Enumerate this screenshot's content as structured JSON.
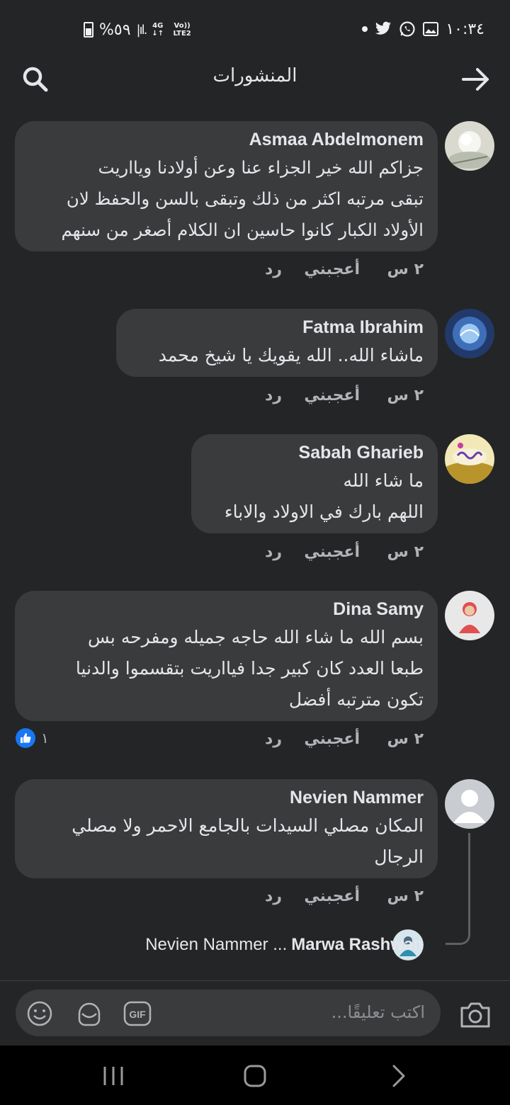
{
  "status_bar": {
    "battery": "%٥٩",
    "network": "4G",
    "volte": "Vo)) LTE2",
    "time": "١٠:٣٤"
  },
  "header": {
    "title": "المنشورات"
  },
  "comments": [
    {
      "author": "Asmaa Abdelmonem",
      "text": "جزاكم الله خير الجزاء عنا وعن أولادنا ويااريت\nتبقى مرتبه اكثر من ذلك وتبقى بالسن والحفظ لان\nالأولاد الكبار كانوا حاسين ان الكلام أصغر من سنهم",
      "time": "٢ س",
      "like_label": "أعجبني",
      "reply_label": "رد"
    },
    {
      "author": "Fatma Ibrahim",
      "text": "ماشاء الله.. الله يقويك يا شيخ محمد",
      "time": "٢ س",
      "like_label": "أعجبني",
      "reply_label": "رد"
    },
    {
      "author": "Sabah Gharieb",
      "text": "ما شاء الله\nاللهم بارك في الاولاد والاباء",
      "time": "٢ س",
      "like_label": "أعجبني",
      "reply_label": "رد"
    },
    {
      "author": "Dina Samy",
      "text": "بسم الله ما شاء الله حاجه جميله ومفرحه بس\nطبعا العدد كان كبير جدا فيااريت بتقسموا والدنيا\nتكون مترتبه أفضل",
      "time": "٢ س",
      "like_label": "أعجبني",
      "reply_label": "رد",
      "reaction_count": "١"
    },
    {
      "author": "Nevien Nammer",
      "text": "المكان مصلي السيدات بالجامع الاحمر ولا مصلي\nالرجال",
      "time": "٢ س",
      "like_label": "أعجبني",
      "reply_label": "رد"
    }
  ],
  "reply_preview": {
    "author": "Marwa Rashwan",
    "text": "Nevien Nammer ..."
  },
  "composer": {
    "placeholder": "اكتب تعليقًا..."
  },
  "icons": {
    "search": "search-icon",
    "back": "arrow-right-icon",
    "camera": "camera-icon",
    "gif": "gif-icon",
    "sticker": "sticker-icon",
    "emoji": "emoji-icon",
    "like": "thumbs-up-icon"
  },
  "colors": {
    "background": "#242526",
    "bubble": "#3a3b3c",
    "accent": "#1877f2"
  }
}
